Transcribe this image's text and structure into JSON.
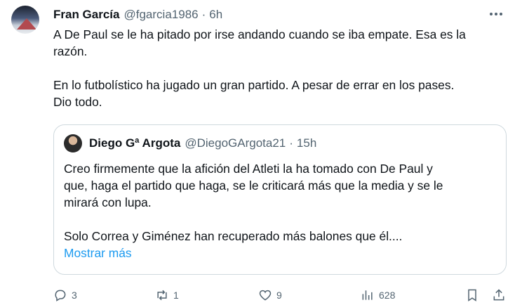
{
  "tweet": {
    "author_name": "Fran García",
    "author_handle": "@fgarcia1986",
    "separator": "·",
    "time": "6h",
    "text_line1": "A De Paul se le ha pitado por irse andando cuando se iba empate. Esa es la",
    "text_line2": "razón.",
    "text_line3": "En lo futbolístico ha jugado un gran partido. A pesar de errar en los pases.",
    "text_line4": "Dio todo."
  },
  "quote": {
    "author_name": "Diego Gª Argota",
    "author_handle": "@DiegoGArgota21",
    "separator": "·",
    "time": "15h",
    "line1": "Creo firmemente que la afición del Atleti la ha tomado con De Paul y",
    "line2": "que, haga el partido que haga, se le criticará más que la media y se le",
    "line3": "mirará con lupa.",
    "line4": "Solo Correa y Giménez han recuperado más balones que él....",
    "show_more": "Mostrar más"
  },
  "actions": {
    "replies": "3",
    "retweets": "1",
    "likes": "9",
    "views": "628"
  },
  "icons": [
    "more-icon",
    "reply-icon",
    "retweet-icon",
    "like-icon",
    "views-icon",
    "bookmark-icon",
    "share-icon"
  ],
  "colors": {
    "link": "#1d9bf0",
    "secondary_text": "#536471",
    "border": "#cfd9de"
  }
}
